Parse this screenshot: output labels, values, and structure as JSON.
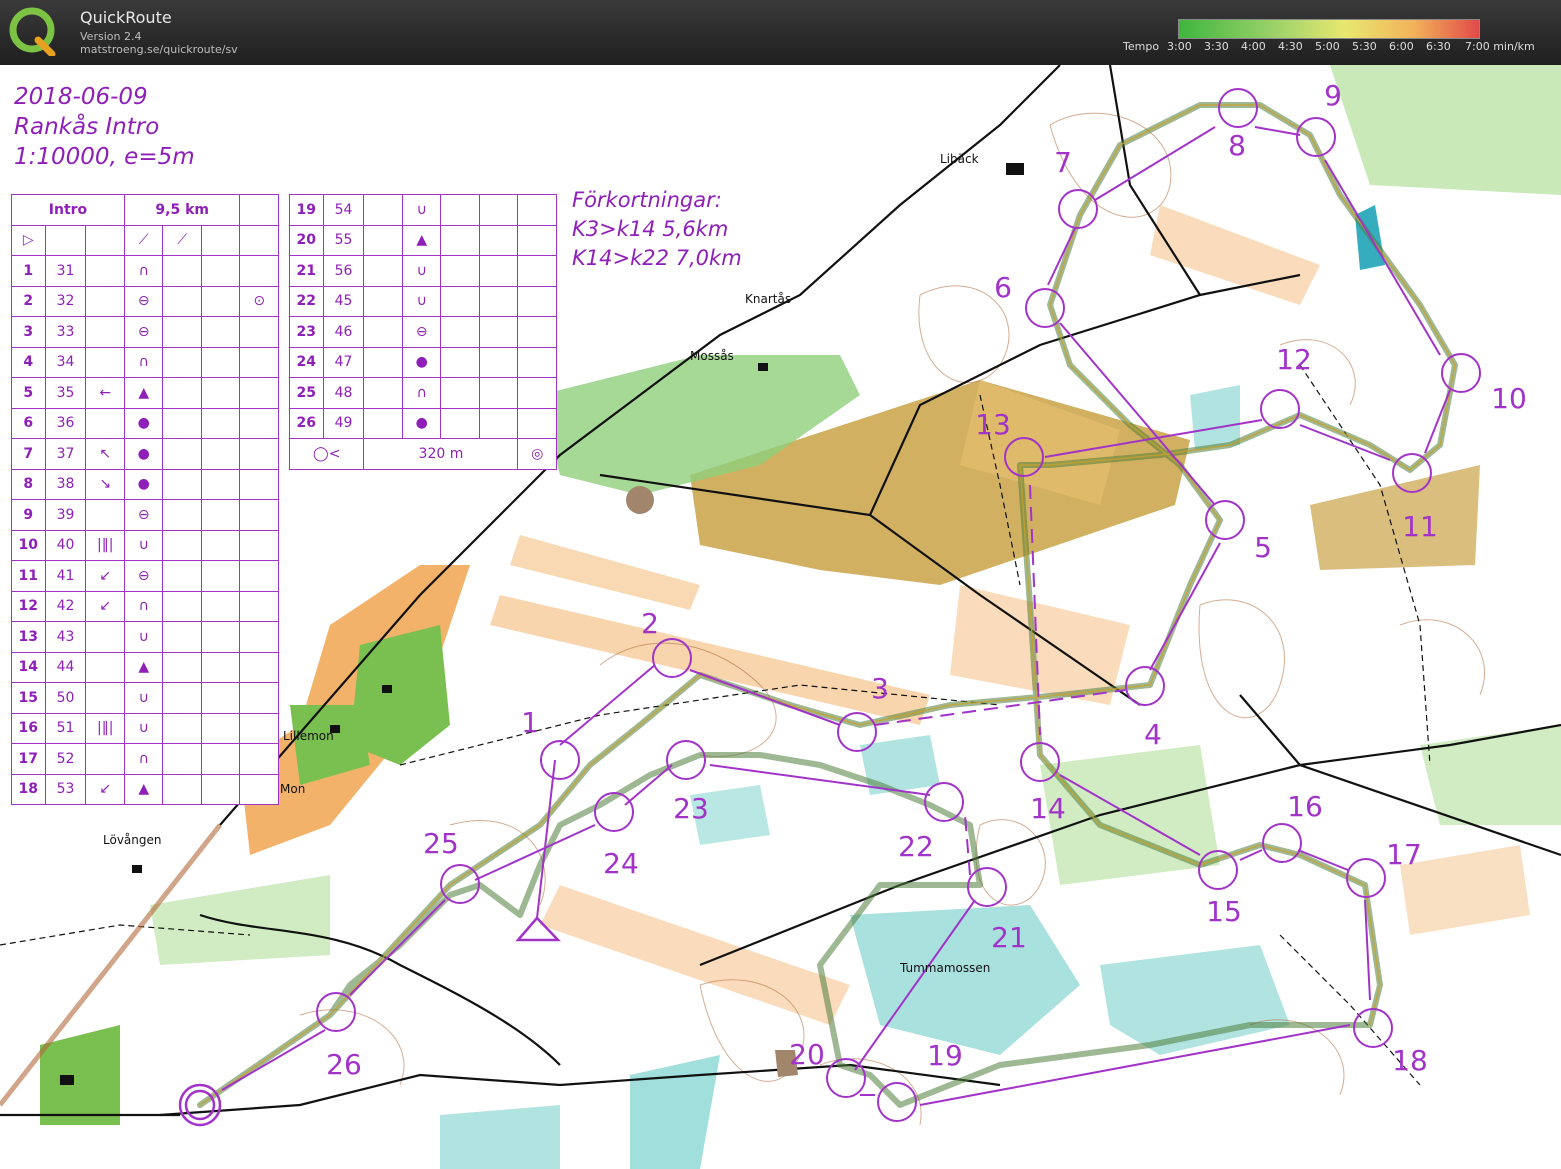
{
  "header": {
    "app_name": "QuickRoute",
    "version": "Version 2.4",
    "url": "matstroeng.se/quickroute/sv",
    "legend_label": "Tempo",
    "legend_ticks": [
      "3:00",
      "3:30",
      "4:00",
      "4:30",
      "5:00",
      "5:30",
      "6:00",
      "6:30",
      "7:00 min/km"
    ],
    "legend_colors": [
      "#3fb53f",
      "#9fd36a",
      "#e8e870",
      "#f2b35a",
      "#e24a4a"
    ]
  },
  "map_info": {
    "date": "2018-06-09",
    "event": "Rankås Intro",
    "scale": "1:10000, e=5m"
  },
  "abbreviations": {
    "title": "Förkortningar:",
    "line1": "K3>k14 5,6km",
    "line2": "K14>k22 7,0km"
  },
  "control_table_left": {
    "class": "Intro",
    "length": "9,5 km",
    "rows": [
      {
        "num": "1",
        "code": "31",
        "c": "",
        "d": "∩"
      },
      {
        "num": "2",
        "code": "32",
        "c": "",
        "d": "⊖",
        "h": "⊙"
      },
      {
        "num": "3",
        "code": "33",
        "c": "",
        "d": "⊖"
      },
      {
        "num": "4",
        "code": "34",
        "c": "",
        "d": "∩"
      },
      {
        "num": "5",
        "code": "35",
        "c": "←",
        "d": "▲"
      },
      {
        "num": "6",
        "code": "36",
        "c": "",
        "d": "●"
      },
      {
        "num": "7",
        "code": "37",
        "c": "↖",
        "d": "●"
      },
      {
        "num": "8",
        "code": "38",
        "c": "↘",
        "d": "●"
      },
      {
        "num": "9",
        "code": "39",
        "c": "",
        "d": "⊖"
      },
      {
        "num": "10",
        "code": "40",
        "c": "|‖|",
        "d": "∪"
      },
      {
        "num": "11",
        "code": "41",
        "c": "↙",
        "d": "⊖"
      },
      {
        "num": "12",
        "code": "42",
        "c": "↙",
        "d": "∩"
      },
      {
        "num": "13",
        "code": "43",
        "c": "",
        "d": "∪"
      },
      {
        "num": "14",
        "code": "44",
        "c": "",
        "d": "▲"
      },
      {
        "num": "15",
        "code": "50",
        "c": "",
        "d": "∪"
      },
      {
        "num": "16",
        "code": "51",
        "c": "|‖|",
        "d": "∪"
      },
      {
        "num": "17",
        "code": "52",
        "c": "",
        "d": "∩"
      },
      {
        "num": "18",
        "code": "53",
        "c": "↙",
        "d": "▲"
      }
    ]
  },
  "control_table_right": {
    "rows": [
      {
        "num": "19",
        "code": "54",
        "d": "∪"
      },
      {
        "num": "20",
        "code": "55",
        "d": "▲"
      },
      {
        "num": "21",
        "code": "56",
        "d": "∪"
      },
      {
        "num": "22",
        "code": "45",
        "d": "∪"
      },
      {
        "num": "23",
        "code": "46",
        "d": "⊖"
      },
      {
        "num": "24",
        "code": "47",
        "d": "●"
      },
      {
        "num": "25",
        "code": "48",
        "d": "∩"
      },
      {
        "num": "26",
        "code": "49",
        "d": "●"
      }
    ],
    "finish_distance": "320 m"
  },
  "places": [
    "Libäck",
    "Knartås",
    "Mossås",
    "Lillemon",
    "Mon",
    "Lövången",
    "Tummamossen"
  ],
  "controls": [
    {
      "n": "1"
    },
    {
      "n": "2"
    },
    {
      "n": "3"
    },
    {
      "n": "4"
    },
    {
      "n": "5"
    },
    {
      "n": "6"
    },
    {
      "n": "7"
    },
    {
      "n": "8"
    },
    {
      "n": "9"
    },
    {
      "n": "10"
    },
    {
      "n": "11"
    },
    {
      "n": "12"
    },
    {
      "n": "13"
    },
    {
      "n": "14"
    },
    {
      "n": "15"
    },
    {
      "n": "16"
    },
    {
      "n": "17"
    },
    {
      "n": "18"
    },
    {
      "n": "19"
    },
    {
      "n": "20"
    },
    {
      "n": "21"
    },
    {
      "n": "22"
    },
    {
      "n": "23"
    },
    {
      "n": "24"
    },
    {
      "n": "25"
    },
    {
      "n": "26"
    }
  ],
  "colors": {
    "course": "#a233c9",
    "route": "#4f7d3a",
    "contour": "#b0693a",
    "open_land": "#f3b26a",
    "rough_open": "#c9a247",
    "forest_green": "#8fd07a",
    "marsh": "#63c9c4"
  }
}
